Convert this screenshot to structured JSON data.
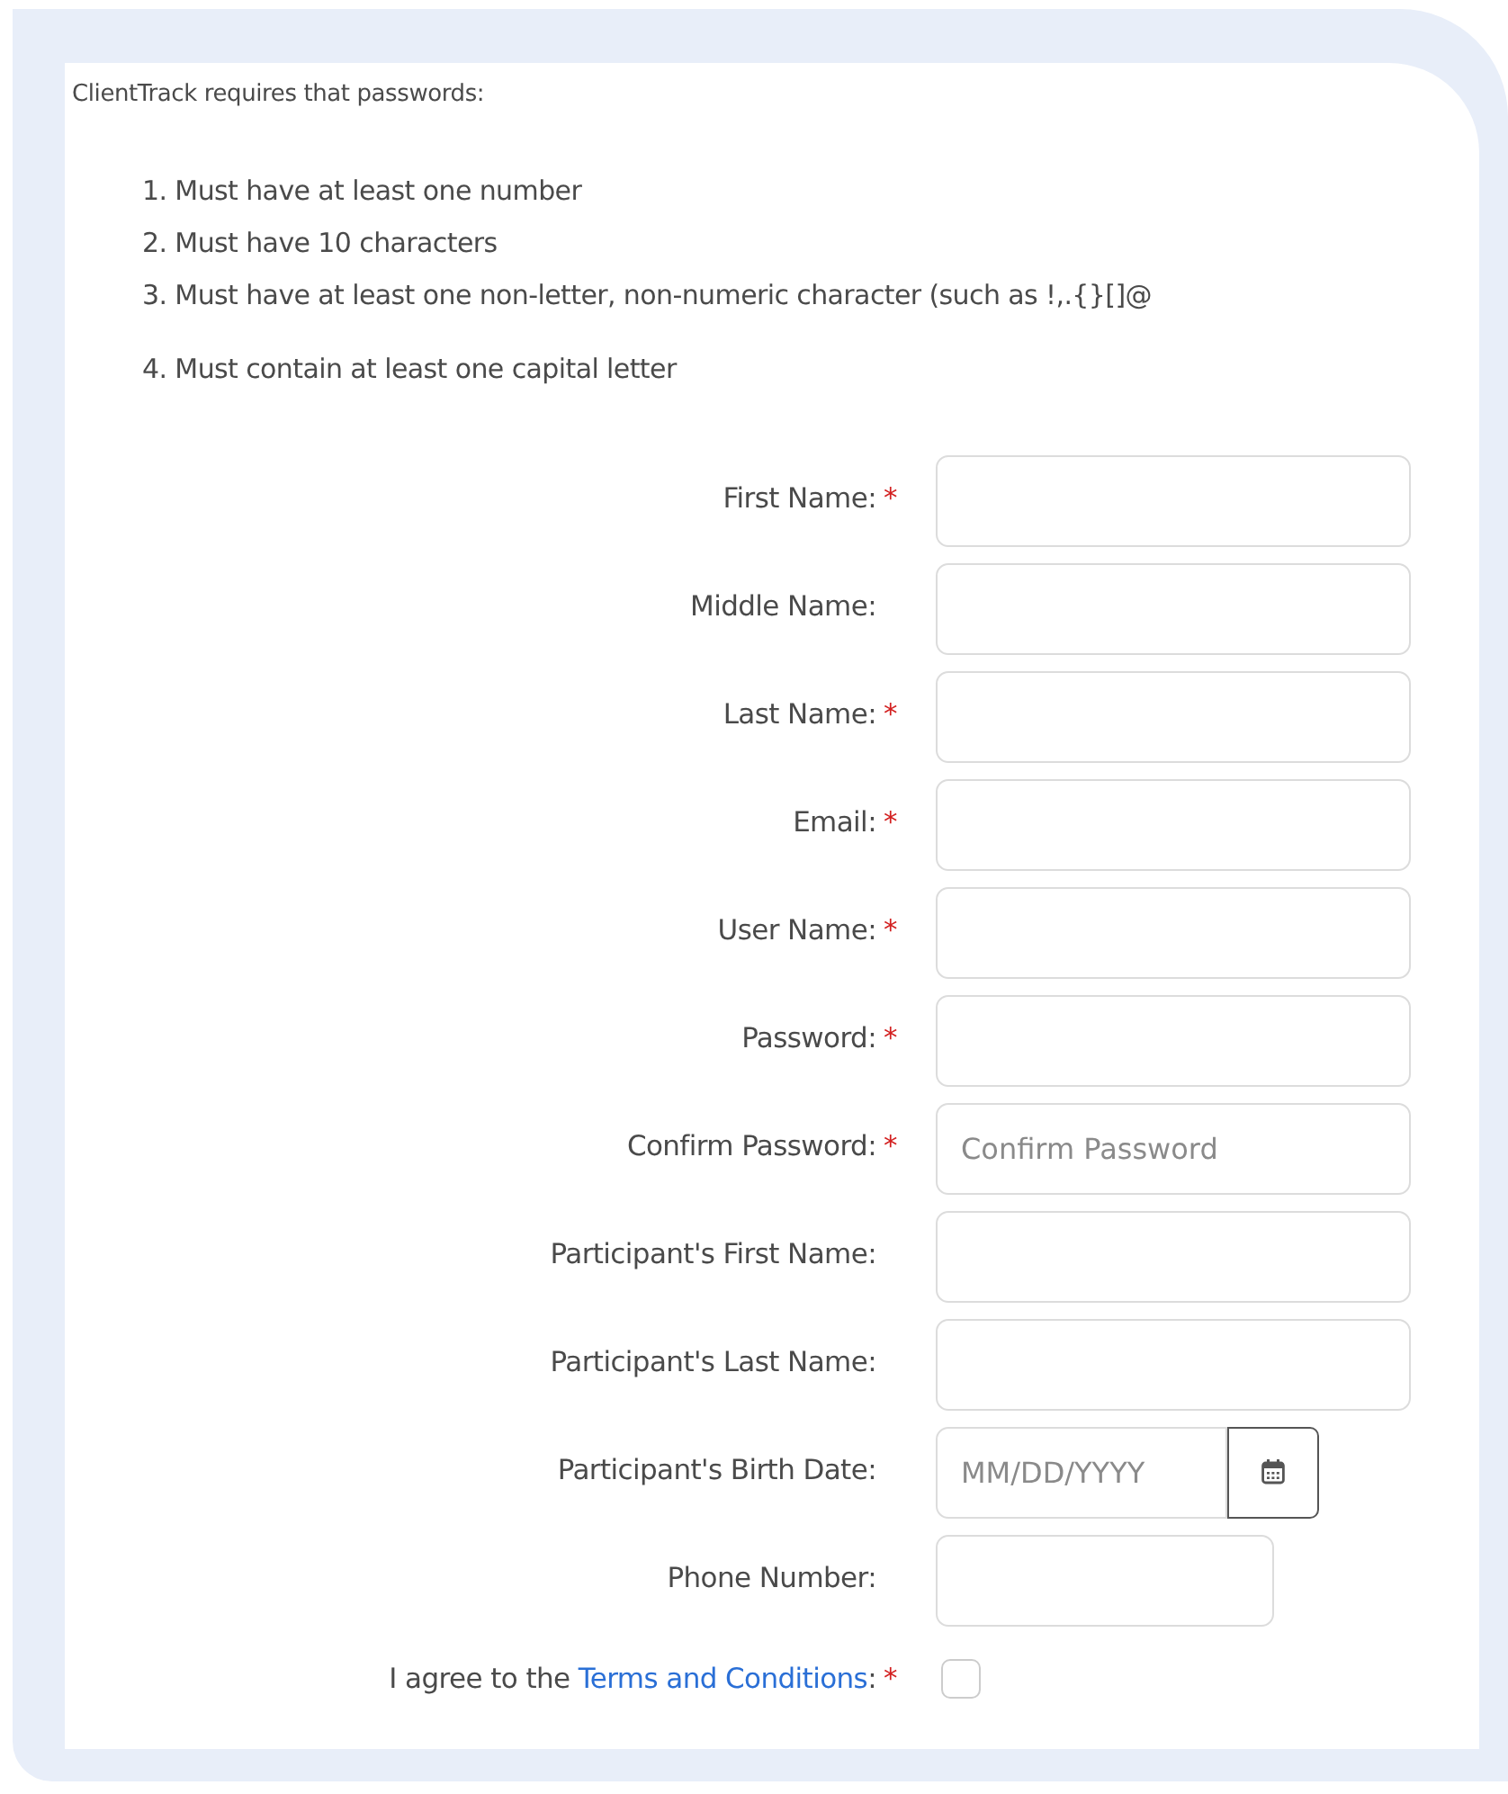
{
  "intro": "ClientTrack requires that passwords:",
  "rules": [
    {
      "number": "1.",
      "text": "Must have at least one number"
    },
    {
      "number": "2.",
      "text": "Must have 10 characters"
    },
    {
      "number": "3.",
      "text": "Must have at least one non-letter, non-numeric character (such as !,.{}[]@"
    },
    {
      "number": "4.",
      "text": "Must contain at least one capital letter"
    }
  ],
  "fields": [
    {
      "kind": "text",
      "label": "First Name:",
      "asterisk": "*"
    },
    {
      "kind": "text",
      "label": "Middle Name:"
    },
    {
      "kind": "text",
      "label": "Last Name:",
      "asterisk": "*"
    },
    {
      "kind": "text",
      "label": "Email:",
      "asterisk": "*"
    },
    {
      "kind": "text",
      "label": "User Name:",
      "asterisk": "*"
    },
    {
      "kind": "text",
      "label": "Password:",
      "asterisk": "*"
    },
    {
      "kind": "text",
      "label": "Confirm Password:",
      "asterisk": "*",
      "placeholder": "Confirm Password"
    },
    {
      "kind": "text",
      "label": "Participant's First Name:"
    },
    {
      "kind": "text",
      "label": "Participant's Last Name:"
    },
    {
      "kind": "date",
      "label": "Participant's Birth Date:",
      "placeholder": "MM/DD/YYYY"
    },
    {
      "kind": "phone",
      "label": "Phone Number:"
    }
  ],
  "terms": {
    "text": "I agree to the ",
    "link": "Terms and Conditions",
    "suffix": ":",
    "asterisk": "*",
    "checked": false
  }
}
